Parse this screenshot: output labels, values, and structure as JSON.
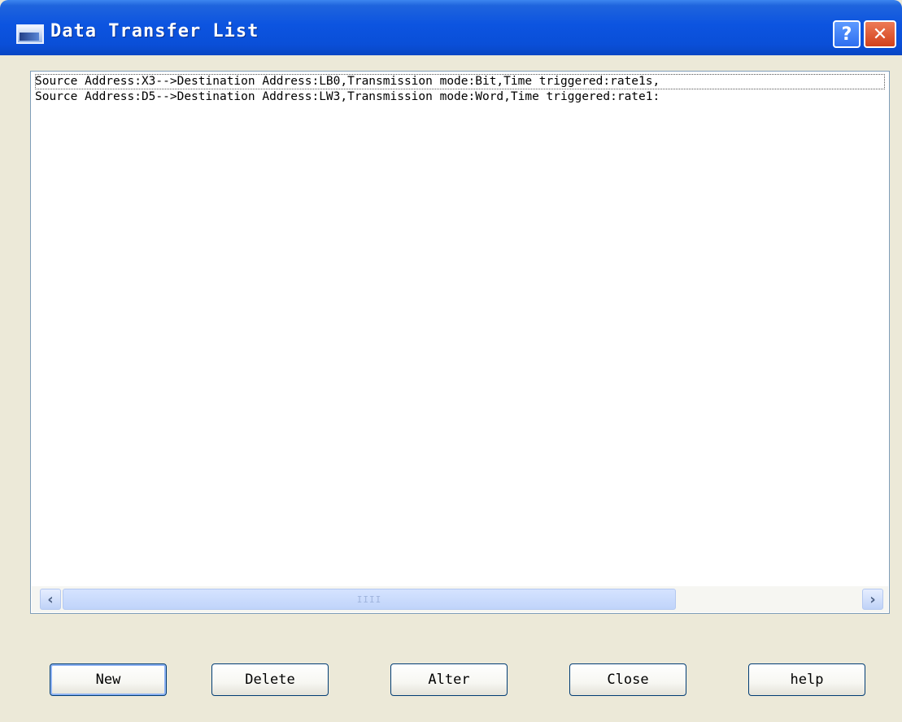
{
  "window": {
    "title": "Data Transfer List"
  },
  "title_buttons": {
    "help_label": "?",
    "close_label": "✕"
  },
  "list": {
    "rows": [
      "Source Address:X3-->Destination Address:LB0,Transmission mode:Bit,Time triggered:rate1s,",
      "Source Address:D5-->Destination Address:LW3,Transmission mode:Word,Time triggered:rate1:"
    ],
    "selected_index": 0
  },
  "scrollbar": {
    "left_arrow": "‹",
    "right_arrow": "›",
    "thumb_grip": "IIII",
    "thumb_fraction": 0.72
  },
  "buttons": {
    "new": "New",
    "delete": "Delete",
    "alter": "Alter",
    "close": "Close",
    "help": "help"
  },
  "icons": {
    "app_icon": "window-icon",
    "help_icon": "question-icon",
    "close_icon": "close-icon"
  }
}
